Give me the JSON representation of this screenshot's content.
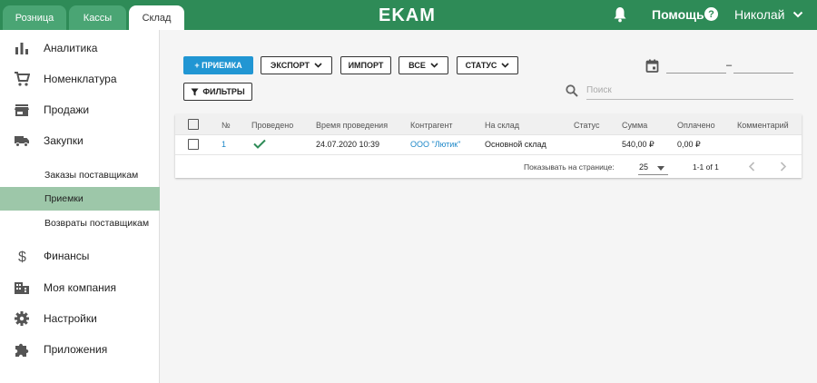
{
  "tabs": [
    {
      "label": "Розница"
    },
    {
      "label": "Кассы"
    },
    {
      "label": "Склад"
    }
  ],
  "logo": "EKAM",
  "header": {
    "help_label": "Помощь",
    "help_icon": "?",
    "user_name": "Николай"
  },
  "sidebar": {
    "items": [
      {
        "label": "Аналитика",
        "icon": "bar-chart-icon"
      },
      {
        "label": "Номенклатура",
        "icon": "cart-icon"
      },
      {
        "label": "Продажи",
        "icon": "store-icon"
      },
      {
        "label": "Закупки",
        "icon": "truck-icon"
      },
      {
        "label": "Финансы",
        "icon": "dollar-icon"
      },
      {
        "label": "Моя компания",
        "icon": "building-icon"
      },
      {
        "label": "Настройки",
        "icon": "gear-icon"
      },
      {
        "label": "Приложения",
        "icon": "puzzle-icon"
      }
    ],
    "subitems": [
      {
        "label": "Заказы поставщикам"
      },
      {
        "label": "Приемки",
        "active": true
      },
      {
        "label": "Возвраты поставщикам"
      }
    ]
  },
  "toolbar": {
    "add_label": "+ ПРИЕМКА",
    "export_label": "ЭКСПОРТ",
    "import_label": "ИМПОРТ",
    "all_label": "ВСЕ",
    "status_label": "СТАТУС",
    "filters_label": "ФИЛЬТРЫ",
    "date_separator": "–",
    "search_placeholder": "Поиск"
  },
  "table": {
    "columns": [
      "№",
      "Проведено",
      "Время проведения",
      "Контрагент",
      "На склад",
      "Статус",
      "Сумма",
      "Оплачено",
      "Комментарий"
    ],
    "rows": [
      {
        "num": "1",
        "done": true,
        "time": "24.07.2020 10:39",
        "counterparty": "ООО \"Лютик\"",
        "warehouse": "Основной склад",
        "status": "",
        "sum": "540,00 ₽",
        "paid": "0,00 ₽",
        "comment": ""
      }
    ],
    "footer": {
      "per_page_label": "Показывать на странице:",
      "per_page": "25",
      "range": "1-1 of 1"
    }
  },
  "colors": {
    "brand": "#2e8b57",
    "accent": "#2196d3",
    "active_sub": "#9dc7a9",
    "link": "#1e88c8"
  }
}
